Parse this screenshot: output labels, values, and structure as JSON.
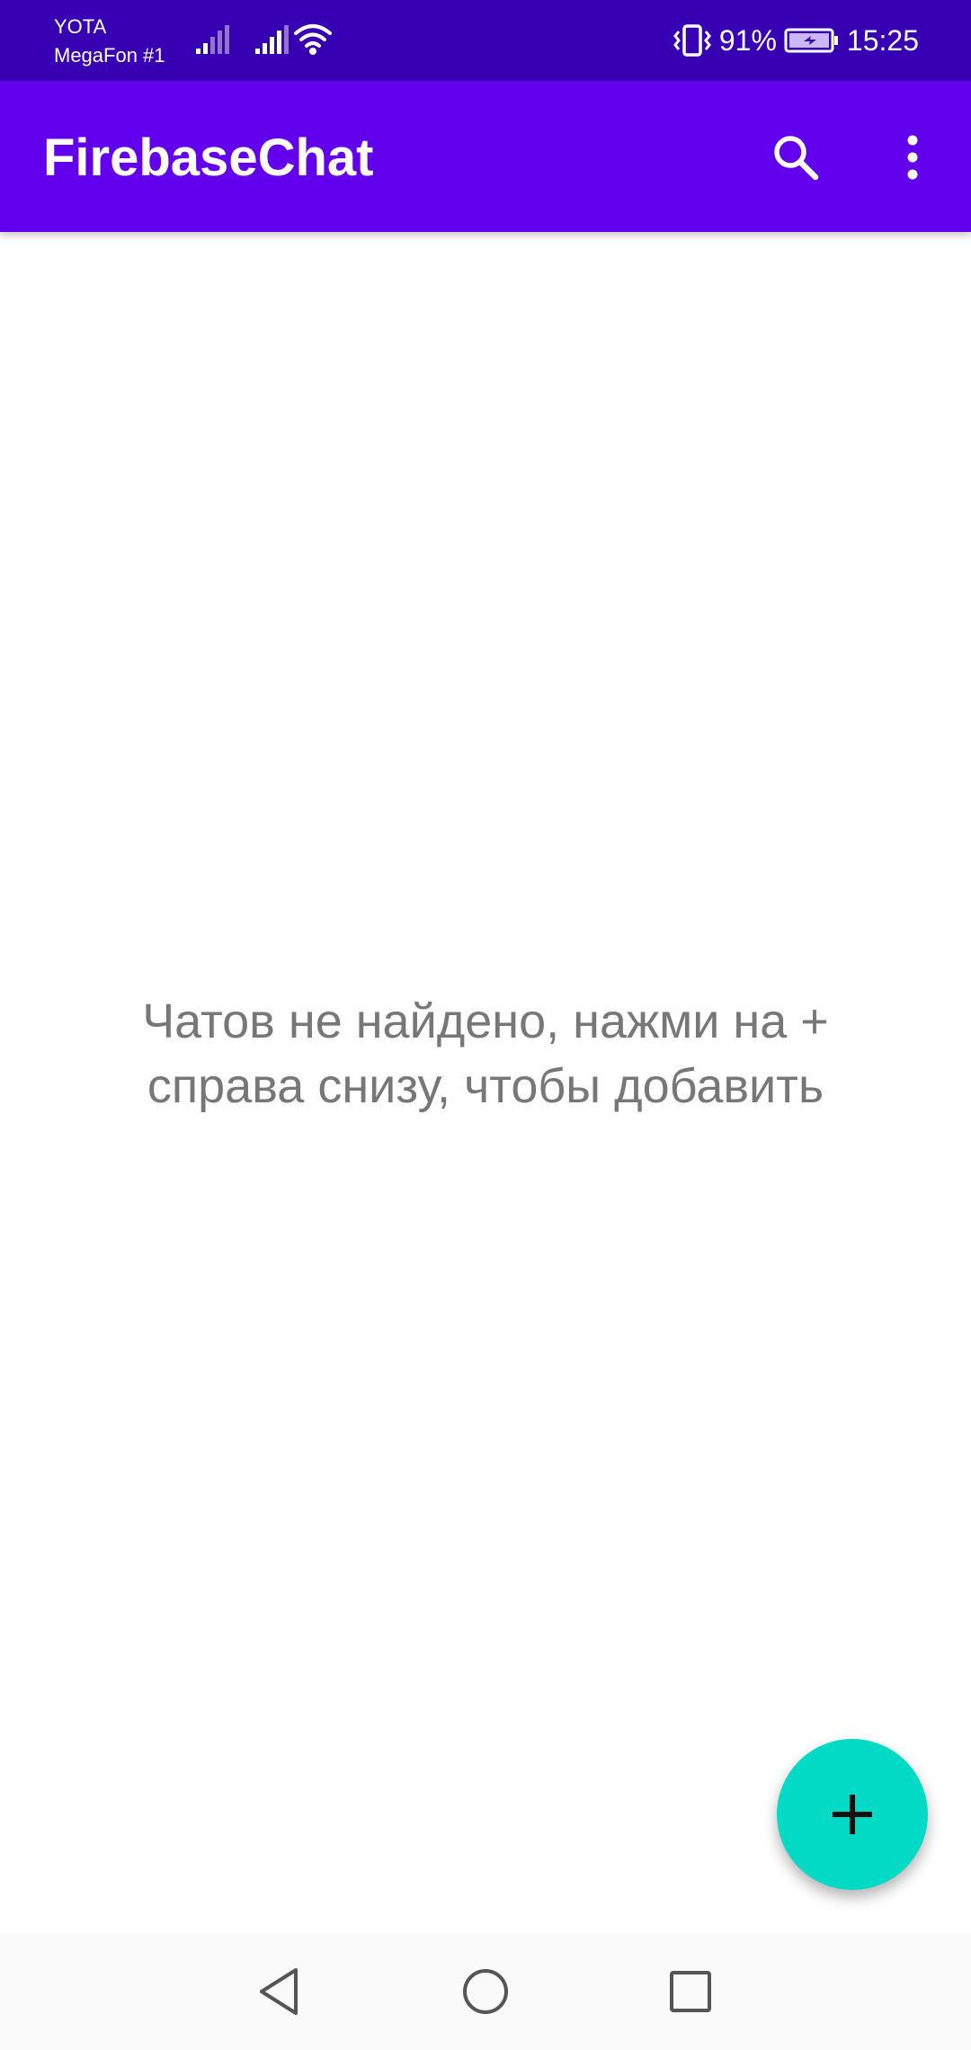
{
  "status_bar": {
    "carrier_1": "YOTA",
    "carrier_2": "MegaFon #1",
    "battery_percent": "91%",
    "time": "15:25",
    "icons": [
      "signal-icon",
      "signal-icon",
      "wifi-icon",
      "vibrate-icon",
      "battery-charging-icon"
    ]
  },
  "app_bar": {
    "title": "FirebaseChat",
    "actions": [
      "search-icon",
      "more-vert-icon"
    ]
  },
  "main": {
    "empty_message": "Чатов не найдено, нажми на + справа снизу, чтобы добавить"
  },
  "fab": {
    "icon": "add-icon"
  },
  "nav_bar": {
    "buttons": [
      "back-icon",
      "home-icon",
      "recents-icon"
    ]
  },
  "colors": {
    "status_bar": "#3700b3",
    "app_bar": "#6200ee",
    "fab": "#03dac5",
    "empty_text": "#777777"
  }
}
